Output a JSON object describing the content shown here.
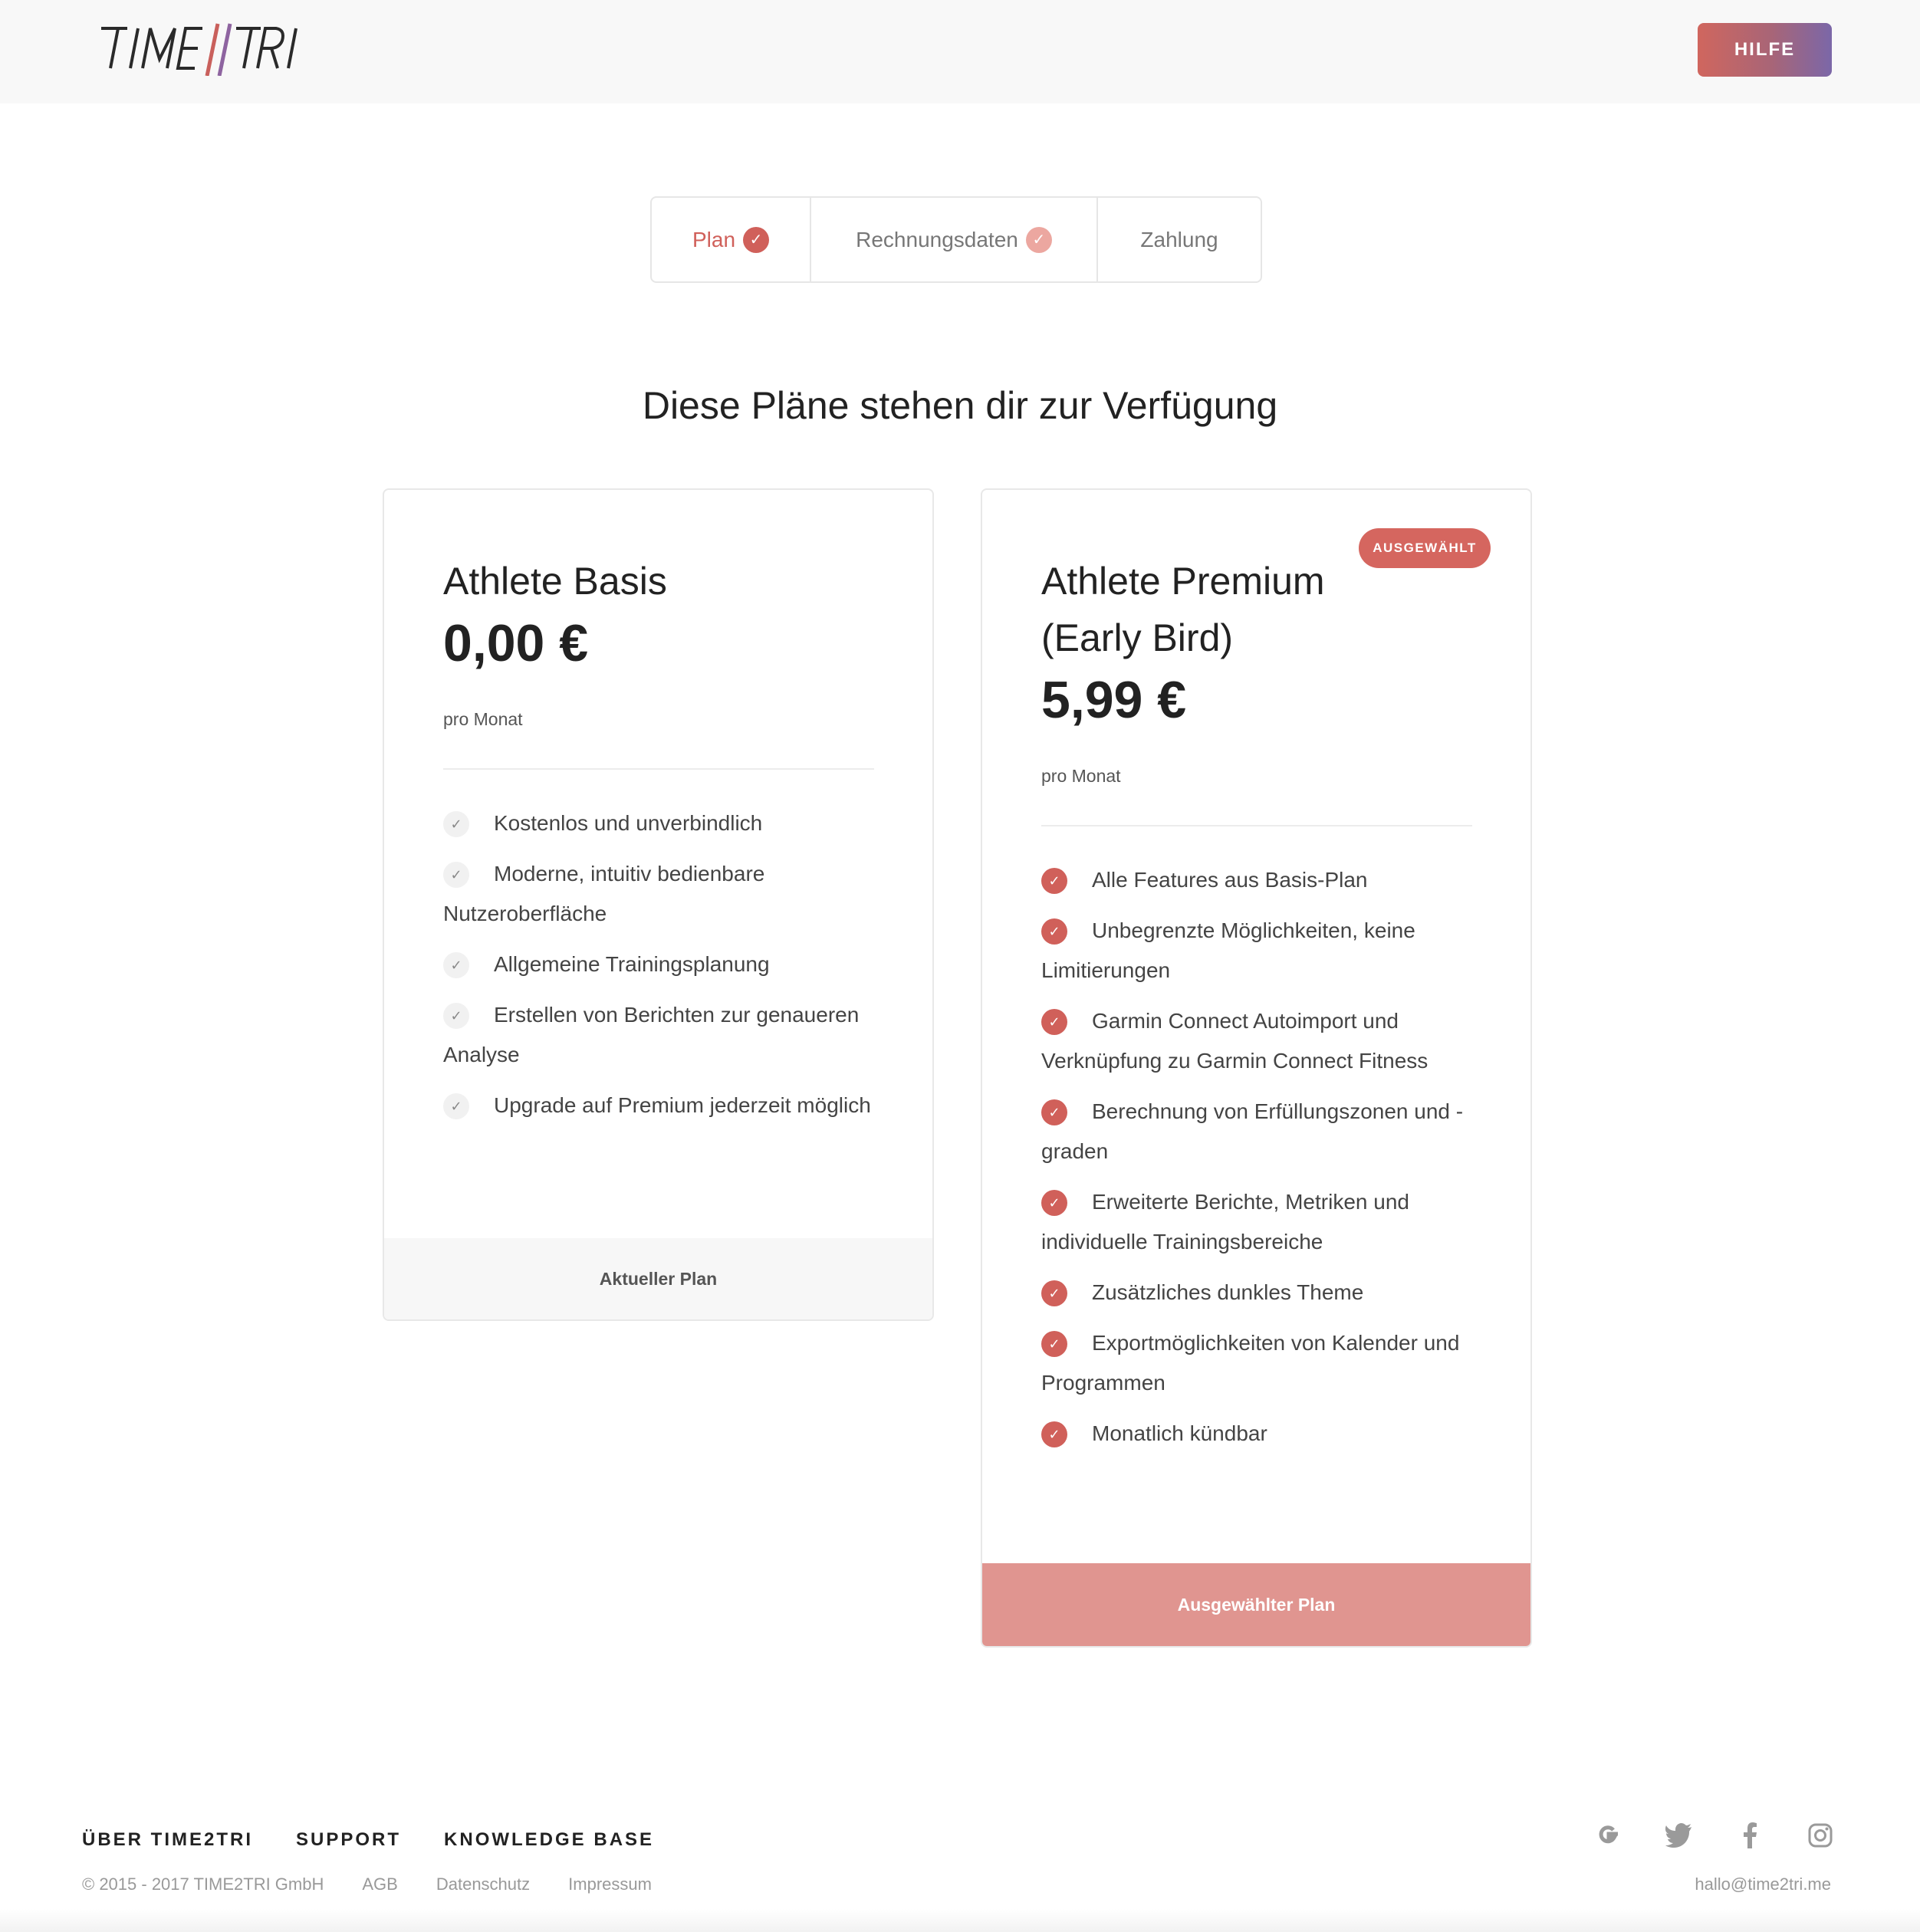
{
  "header": {
    "logo_text": "TIME2TRI",
    "help_label": "HILFE"
  },
  "stepper": {
    "steps": [
      {
        "label": "Plan",
        "state": "done"
      },
      {
        "label": "Rechnungsdaten",
        "state": "done-light"
      },
      {
        "label": "Zahlung",
        "state": "pending"
      }
    ]
  },
  "main": {
    "heading": "Diese Pläne stehen dir zur Verfügung"
  },
  "plans": [
    {
      "name": "Athlete Basis",
      "price": "0,00 €",
      "period": "pro Monat",
      "features": [
        "Kostenlos und unverbindlich",
        "Moderne, intuitiv bedienbare Nutzeroberfläche",
        "Allgemeine Trainingsplanung",
        "Erstellen von Berichten zur genaueren Analyse",
        "Upgrade auf Premium jederzeit möglich"
      ],
      "footer_label": "Aktueller Plan"
    },
    {
      "name_line1": "Athlete Premium",
      "name_line2": "(Early Bird)",
      "price": "5,99 €",
      "period": "pro Monat",
      "badge": "AUSGEWÄHLT",
      "features": [
        "Alle Features aus Basis-Plan",
        "Unbegrenzte Möglichkeiten, keine Limitierungen",
        "Garmin Connect Autoimport und Verknüpfung zu Garmin Connect Fitness",
        "Berechnung von Erfüllungszonen und -graden",
        "Erweiterte Berichte, Metriken und individuelle Trainingsbereiche",
        "Zusätzliches dunkles Theme",
        "Exportmöglichkeiten von Kalender und Programmen",
        "Monatlich kündbar"
      ],
      "footer_label": "Ausgewählter Plan"
    }
  ],
  "footer": {
    "nav": [
      "ÜBER TIME2TRI",
      "SUPPORT",
      "KNOWLEDGE BASE"
    ],
    "copyright": "© 2015 - 2017 TIME2TRI GmbH",
    "legal_links": [
      "AGB",
      "Datenschutz",
      "Impressum"
    ],
    "social": [
      "google-icon",
      "twitter-icon",
      "facebook-icon",
      "instagram-icon"
    ],
    "email": "hallo@time2tri.me"
  },
  "colors": {
    "accent": "#d0605a",
    "accent_light": "#e09590",
    "help_gradient_start": "#d0665e",
    "help_gradient_end": "#7b67a8"
  }
}
